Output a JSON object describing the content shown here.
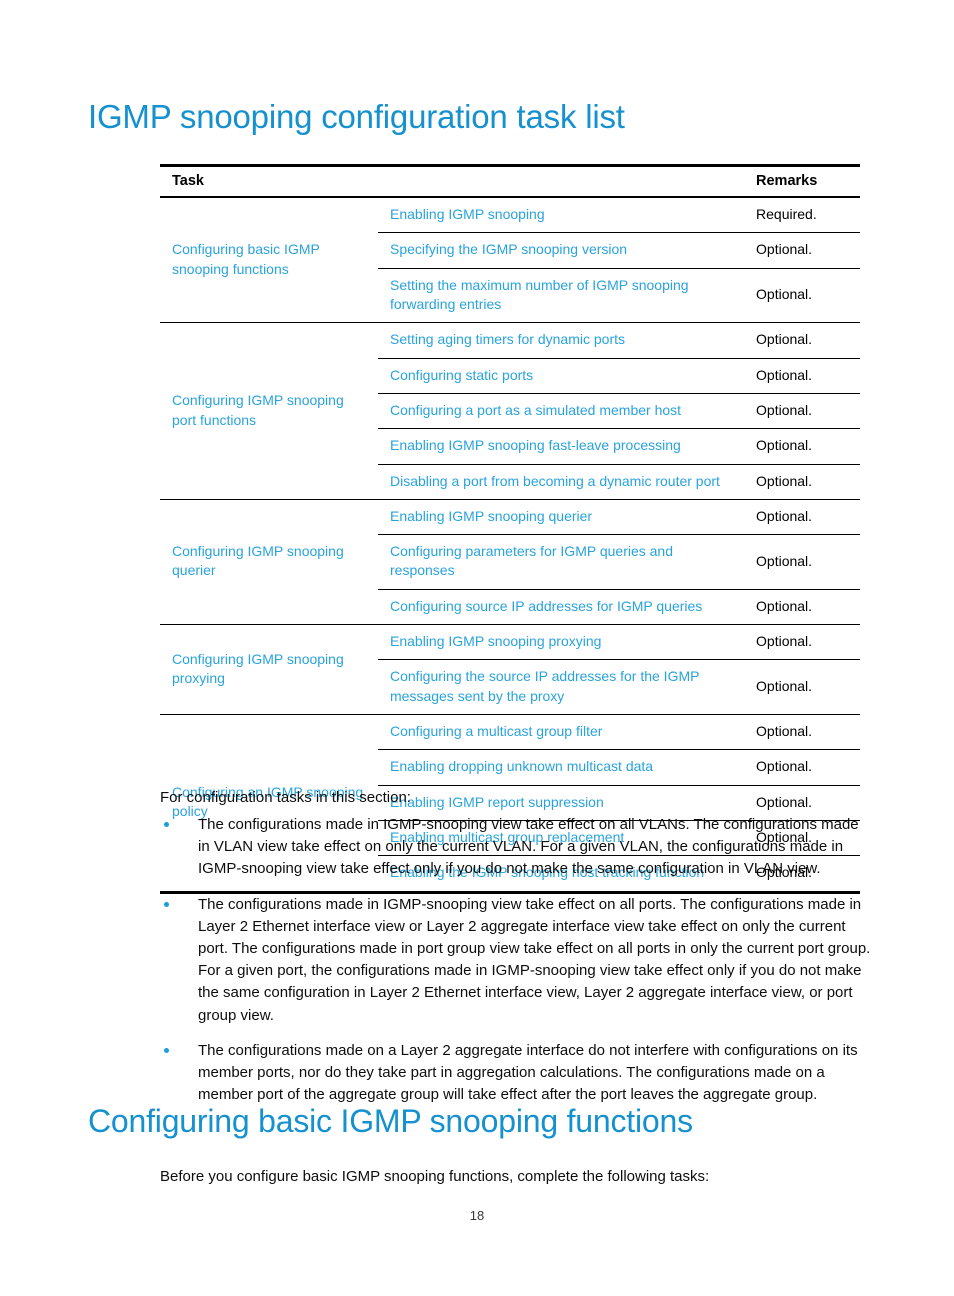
{
  "headings": {
    "task_list": "IGMP snooping configuration task list",
    "basic_functions": "Configuring basic IGMP snooping functions"
  },
  "table": {
    "columns": {
      "task": "Task",
      "remarks": "Remarks"
    },
    "groups": [
      {
        "name": "Configuring basic IGMP snooping functions",
        "rows": [
          {
            "task": "Enabling IGMP snooping",
            "remarks": "Required."
          },
          {
            "task": "Specifying the IGMP snooping version",
            "remarks": "Optional."
          },
          {
            "task": "Setting the maximum number of IGMP snooping forwarding entries",
            "remarks": "Optional."
          }
        ]
      },
      {
        "name": "Configuring IGMP snooping port functions",
        "rows": [
          {
            "task": "Setting aging timers for dynamic ports",
            "remarks": "Optional."
          },
          {
            "task": "Configuring static ports",
            "remarks": "Optional."
          },
          {
            "task": "Configuring a port as a simulated member host",
            "remarks": "Optional."
          },
          {
            "task": "Enabling IGMP snooping fast-leave processing",
            "remarks": "Optional."
          },
          {
            "task": "Disabling a port from becoming a dynamic router port",
            "remarks": "Optional."
          }
        ]
      },
      {
        "name": "Configuring IGMP snooping querier",
        "rows": [
          {
            "task": "Enabling IGMP snooping querier",
            "remarks": "Optional."
          },
          {
            "task": "Configuring parameters for IGMP queries and responses",
            "remarks": "Optional."
          },
          {
            "task": "Configuring source IP addresses for IGMP queries",
            "remarks": "Optional."
          }
        ]
      },
      {
        "name": "Configuring IGMP snooping proxying",
        "rows": [
          {
            "task": "Enabling IGMP snooping proxying",
            "remarks": "Optional."
          },
          {
            "task": "Configuring the source IP addresses for the IGMP messages sent by the proxy",
            "remarks": "Optional."
          }
        ]
      },
      {
        "name": "Configuring an IGMP snooping policy",
        "rows": [
          {
            "task": "Configuring a multicast group filter",
            "remarks": "Optional."
          },
          {
            "task": "Enabling dropping unknown multicast data",
            "remarks": "Optional."
          },
          {
            "task": "Enabling IGMP report suppression",
            "remarks": "Optional."
          },
          {
            "task": "Enabling multicast group replacement",
            "remarks": "Optional."
          },
          {
            "task": "Enabling the IGMP snooping host tracking function",
            "remarks": "Optional."
          }
        ]
      }
    ]
  },
  "body": {
    "intro": "For configuration tasks in this section:",
    "bullets": [
      "The configurations made in IGMP-snooping view take effect on all VLANs. The configurations made in VLAN view take effect on only the current VLAN. For a given VLAN, the configurations made in IGMP-snooping view take effect only if you do not make the same configuration in VLAN view.",
      "The configurations made in IGMP-snooping view take effect on all ports. The configurations made in Layer 2 Ethernet interface view or Layer 2 aggregate interface view take effect on only the current port. The configurations made in port group view take effect on all ports in only the current port group. For a given port, the configurations made in IGMP-snooping view take effect only if you do not make the same configuration in Layer 2 Ethernet interface view, Layer 2 aggregate interface view, or port group view.",
      "The configurations made on a Layer 2 aggregate interface do not interfere with configurations on its member ports, nor do they take part in aggregation calculations. The configurations made on a member port of the aggregate group will take effect after the port leaves the aggregate group."
    ],
    "before_note": "Before you configure basic IGMP snooping functions, complete the following tasks:"
  },
  "footer": {
    "page_number": "18"
  },
  "colors": {
    "heading_blue": "#1491CE",
    "link_blue": "#29A3DC",
    "bullet_blue": "#1C9ED8",
    "rule_black": "#000000"
  }
}
